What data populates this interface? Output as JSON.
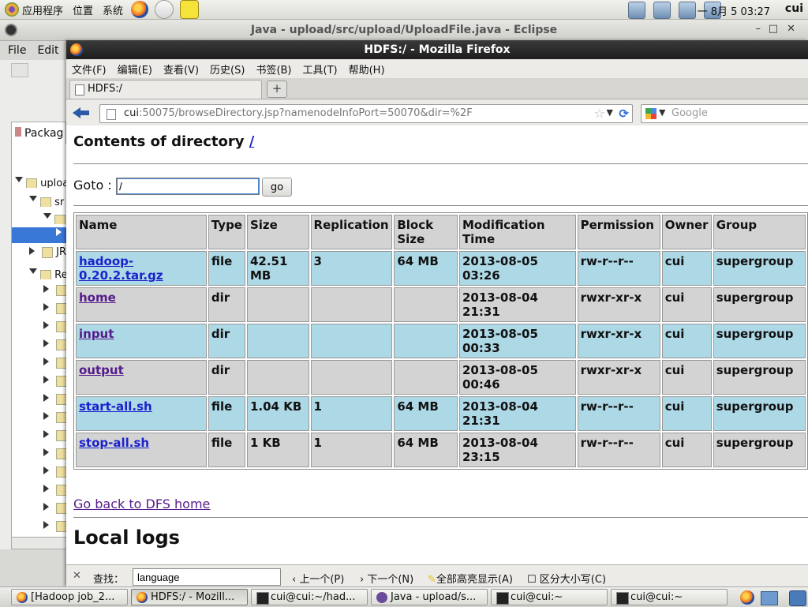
{
  "top_panel": {
    "menus": [
      "应用程序",
      "位置",
      "系统"
    ],
    "clock": "一 8月  5 03:27",
    "user": "cui"
  },
  "eclipse": {
    "title": "Java - upload/src/upload/UploadFile.java - Eclipse",
    "menu": [
      "File",
      "Edit"
    ],
    "view_tab": "Packag",
    "tree_rows": [
      "uploa",
      "sr",
      "",
      "",
      "JR",
      "Re"
    ],
    "window_controls": [
      "–",
      "□",
      "✕"
    ]
  },
  "firefox": {
    "title": "HDFS:/ - Mozilla Firefox",
    "menu": [
      "文件(F)",
      "编辑(E)",
      "查看(V)",
      "历史(S)",
      "书签(B)",
      "工具(T)",
      "帮助(H)"
    ],
    "tab_label": "HDFS:/",
    "new_tab": "+",
    "url_host": "cui",
    "url_rest": ":50075/browseDirectory.jsp?namenodeInfoPort=50070&dir=%2F",
    "search_placeholder": "Google"
  },
  "page": {
    "heading": "Contents of directory ",
    "heading_link": "/",
    "goto_label": "Goto : ",
    "goto_value": "/",
    "go_button": "go",
    "columns": [
      "Name",
      "Type",
      "Size",
      "Replication",
      "Block Size",
      "Modification Time",
      "Permission",
      "Owner",
      "Group"
    ],
    "rows": [
      {
        "name": "hadoop-0.20.2.tar.gz",
        "type": "file",
        "size": "42.51 MB",
        "replication": "3",
        "block": "64 MB",
        "mtime": "2013-08-05 03:26",
        "perm": "rw-r--r--",
        "owner": "cui",
        "group": "supergroup"
      },
      {
        "name": "home",
        "type": "dir",
        "size": "",
        "replication": "",
        "block": "",
        "mtime": "2013-08-04 21:31",
        "perm": "rwxr-xr-x",
        "owner": "cui",
        "group": "supergroup"
      },
      {
        "name": "input",
        "type": "dir",
        "size": "",
        "replication": "",
        "block": "",
        "mtime": "2013-08-05 00:33",
        "perm": "rwxr-xr-x",
        "owner": "cui",
        "group": "supergroup"
      },
      {
        "name": "output",
        "type": "dir",
        "size": "",
        "replication": "",
        "block": "",
        "mtime": "2013-08-05 00:46",
        "perm": "rwxr-xr-x",
        "owner": "cui",
        "group": "supergroup"
      },
      {
        "name": "start-all.sh",
        "type": "file",
        "size": "1.04 KB",
        "replication": "1",
        "block": "64 MB",
        "mtime": "2013-08-04 21:31",
        "perm": "rw-r--r--",
        "owner": "cui",
        "group": "supergroup"
      },
      {
        "name": "stop-all.sh",
        "type": "file",
        "size": "1 KB",
        "replication": "1",
        "block": "64 MB",
        "mtime": "2013-08-04 23:15",
        "perm": "rw-r--r--",
        "owner": "cui",
        "group": "supergroup"
      }
    ],
    "back_link": "Go back to DFS home",
    "logs_heading": "Local logs"
  },
  "findbar": {
    "label": "查找：",
    "value": "language",
    "prev": "上一个(P)",
    "next": "下一个(N)",
    "highlight": "全部高亮显示(A)",
    "match_case": "区分大小写(C)"
  },
  "taskbar": [
    {
      "label": "[Hadoop job_2...",
      "icon": "firefox-icon"
    },
    {
      "label": "HDFS:/ - Mozill...",
      "icon": "firefox-icon"
    },
    {
      "label": "cui@cui:~/had...",
      "icon": "terminal-icon"
    },
    {
      "label": "Java - upload/s...",
      "icon": "eclipse-icon"
    },
    {
      "label": "cui@cui:~",
      "icon": "terminal-icon"
    },
    {
      "label": "cui@cui:~",
      "icon": "terminal-icon"
    }
  ]
}
